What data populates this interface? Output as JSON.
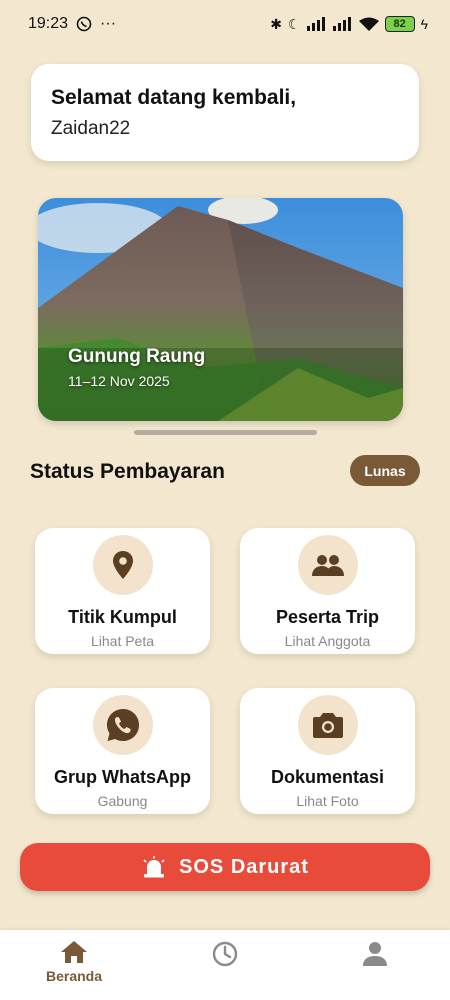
{
  "status_bar": {
    "time": "19:23",
    "battery": "82"
  },
  "welcome": {
    "title": "Selamat datang kembali,",
    "username": "Zaidan22"
  },
  "hero": {
    "title": "Gunung Raung",
    "date": "11–12 Nov 2025"
  },
  "payment": {
    "title": "Status Pembayaran",
    "status": "Lunas"
  },
  "menu": [
    {
      "label": "Titik Kumpul",
      "sub": "Lihat Peta",
      "icon": "location-pin-icon"
    },
    {
      "label": "Peserta Trip",
      "sub": "Lihat Anggota",
      "icon": "group-icon"
    },
    {
      "label": "Grup WhatsApp",
      "sub": "Gabung",
      "icon": "whatsapp-icon"
    },
    {
      "label": "Dokumentasi",
      "sub": "Lihat Foto",
      "icon": "camera-icon"
    }
  ],
  "sos": {
    "label": "SOS Darurat",
    "icon": "siren-icon"
  },
  "nav": {
    "home_label": "Beranda",
    "active": "home",
    "items": [
      "home-icon",
      "history-clock-icon",
      "profile-icon"
    ]
  },
  "colors": {
    "background": "#F3E8CF",
    "brown": "#7A5A36",
    "sos_red": "#E84B3A",
    "icon_circle": "#F3E3CC"
  }
}
